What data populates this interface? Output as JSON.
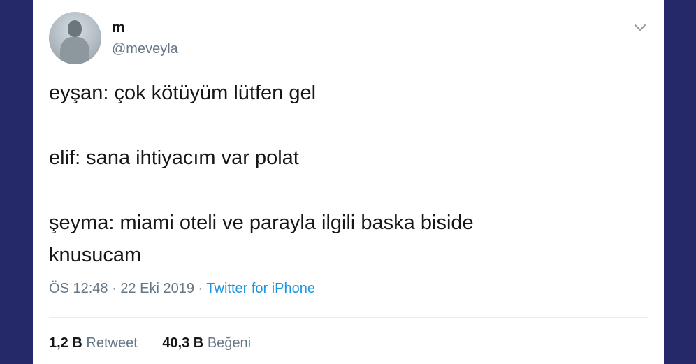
{
  "tweet": {
    "author": {
      "display_name": "m",
      "handle": "@meveyla"
    },
    "menu_icon": "chevron-down-icon",
    "lines": [
      "eyşan: çok kötüyüm lütfen gel",
      "elif: sana ihtiyacım var polat",
      "şeyma: miami oteli ve parayla ilgili baska biside",
      "knusucam"
    ],
    "meta": {
      "time": "ÖS 12:48",
      "separator": "·",
      "date": "22 Eki 2019",
      "source": "Twitter for iPhone"
    },
    "stats": {
      "retweets_count": "1,2 B",
      "retweets_label": "Retweet",
      "likes_count": "40,3 B",
      "likes_label": "Beğeni"
    }
  },
  "colors": {
    "background": "#262969",
    "card": "#ffffff",
    "text": "#14171a",
    "secondary": "#657786",
    "link": "#1b95e0"
  }
}
